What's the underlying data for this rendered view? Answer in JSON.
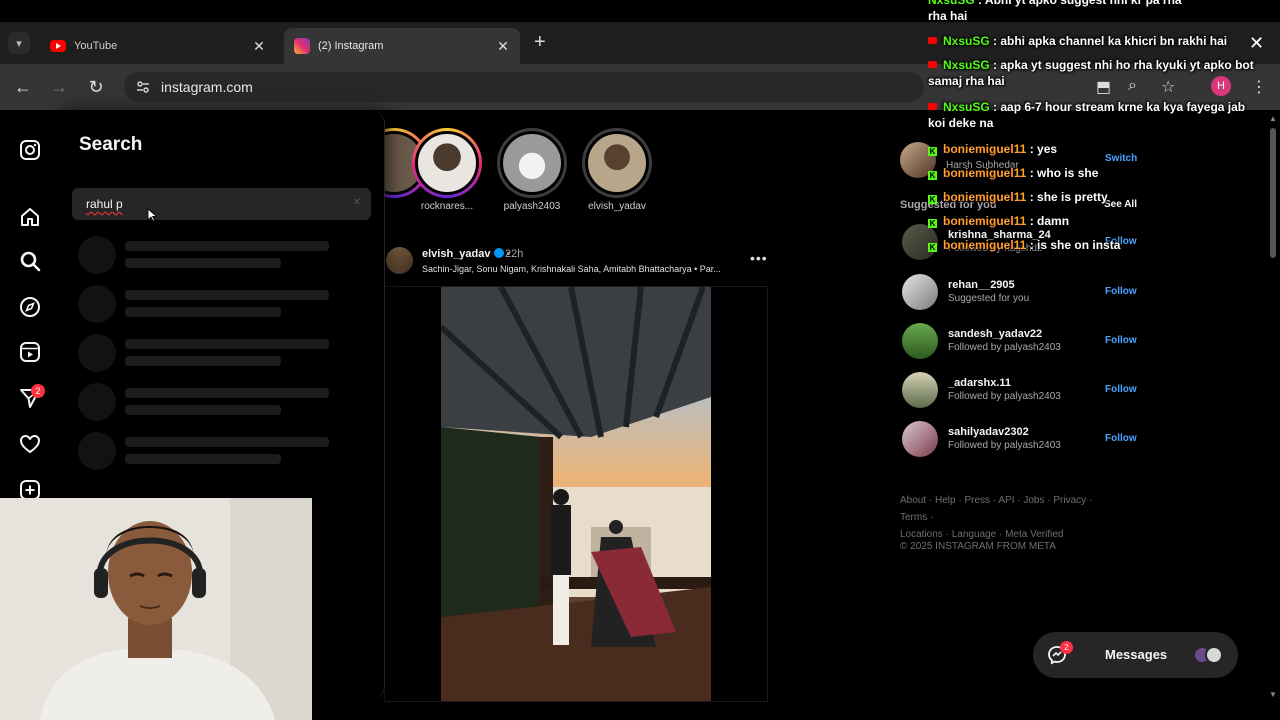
{
  "browser": {
    "tabs": [
      {
        "title": "YouTube",
        "favicon": "youtube-icon"
      },
      {
        "title": "(2) Instagram",
        "favicon": "instagram-icon",
        "active": true
      }
    ],
    "url": "instagram.com",
    "profile_initial": "H"
  },
  "rail": {
    "icons": [
      "instagram-logo-icon",
      "home-icon",
      "search-icon",
      "explore-compass-icon",
      "reels-icon",
      "direct-send-icon",
      "heart-icon",
      "create-plus-icon"
    ],
    "notifications_badge": "2"
  },
  "search": {
    "title": "Search",
    "query": "rahul p",
    "loading_rows": 5
  },
  "stories": [
    {
      "name": ""
    },
    {
      "name": "rocknares..."
    },
    {
      "name": "palyash2403"
    },
    {
      "name": "elvish_yadav"
    }
  ],
  "post": {
    "username": "elvish_yadav",
    "time": "22h",
    "subtitle": "Sachin-Jigar, Sonu Nigam, Krishnakali Saha, Amitabh Bhattacharya • Par..."
  },
  "sidebar": {
    "current_user_name": "Harsh Subhedar",
    "switch_label": "Switch",
    "suggested_header": "Suggested for you",
    "see_all_label": "See All",
    "suggestions": [
      {
        "username": "krishna_sharma_24",
        "sub": "Followed by nagshdz",
        "follow": "Follow"
      },
      {
        "username": "rehan__2905",
        "sub": "Suggested for you",
        "follow": "Follow"
      },
      {
        "username": "sandesh_yadav22",
        "sub": "Followed by palyash2403",
        "follow": "Follow"
      },
      {
        "username": "_adarshx.11",
        "sub": "Followed by palyash2403",
        "follow": "Follow"
      },
      {
        "username": "sahilyadav2302",
        "sub": "Followed by palyash2403",
        "follow": "Follow"
      }
    ],
    "footer_line1": "About · Help · Press · API · Jobs · Privacy · Terms ·",
    "footer_line2": "Locations · Language · Meta Verified",
    "copyright": "© 2025 INSTAGRAM FROM META"
  },
  "messages": {
    "label": "Messages",
    "badge": "2"
  },
  "chat": [
    {
      "platform": "youtube",
      "user": "NxsuSG",
      "text": " : abhi apka channel ka khicri bn rakhi hai"
    },
    {
      "platform": "youtube",
      "user": "NxsuSG",
      "text": " : apka yt suggest nhi ho rha kyuki yt apko bot samaj rha hai"
    },
    {
      "platform": "youtube",
      "user": "NxsuSG",
      "text": " : aap 6-7 hour stream krne ka kya fayega jab koi deke na"
    },
    {
      "platform": "kick",
      "user": "boniemiguel11",
      "text": " : yes"
    },
    {
      "platform": "kick",
      "user": "boniemiguel11",
      "text": " : who is she"
    },
    {
      "platform": "kick",
      "user": "boniemiguel11",
      "text": " : she is pretty"
    },
    {
      "platform": "kick",
      "user": "boniemiguel11",
      "text": " : damn"
    },
    {
      "platform": "kick",
      "user": "boniemiguel11",
      "text": " : is she on insta"
    }
  ],
  "chat_top_fragment": "rha hai",
  "colors": {
    "accent_link": "#4aa3ff",
    "badge_red": "#ff3040",
    "yt_user": "#53fc18",
    "kick_user": "#ff9d2e"
  }
}
